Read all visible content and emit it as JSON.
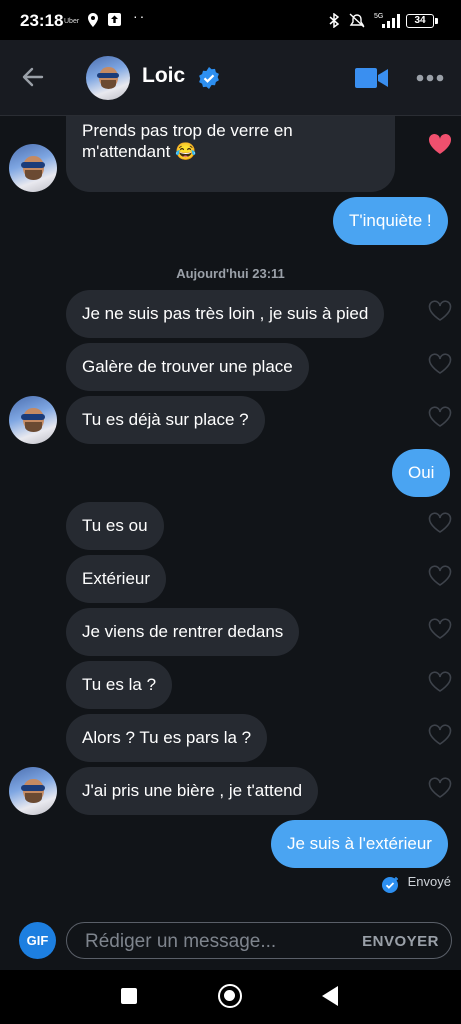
{
  "status_bar": {
    "time": "23:18",
    "uber": "Uber",
    "network": "5G",
    "battery": "34"
  },
  "header": {
    "contact_name": "Loic"
  },
  "messages": [
    {
      "direction": "in",
      "text": "Prends pas trop de verre en m'attendant 😂",
      "liked": true
    },
    {
      "direction": "out",
      "text": "T'inquiète !"
    },
    {
      "direction": "in",
      "text": "Je ne suis pas très loin , je suis à pied",
      "liked": false
    },
    {
      "direction": "in",
      "text": "Galère de trouver une place",
      "liked": false
    },
    {
      "direction": "in",
      "text": "Tu es déjà sur place ?",
      "liked": false
    },
    {
      "direction": "out",
      "text": "Oui"
    },
    {
      "direction": "in",
      "text": "Tu es ou",
      "liked": false
    },
    {
      "direction": "in",
      "text": "Extérieur",
      "liked": false
    },
    {
      "direction": "in",
      "text": "Je viens de rentrer dedans",
      "liked": false
    },
    {
      "direction": "in",
      "text": "Tu es la ?",
      "liked": false
    },
    {
      "direction": "in",
      "text": "Alors ? Tu es pars la ?",
      "liked": false
    },
    {
      "direction": "in",
      "text": "J'ai pris une bière , je t'attend",
      "liked": false
    },
    {
      "direction": "out",
      "text": "Je suis à l'extérieur"
    }
  ],
  "date_separator": "Aujourd'hui 23:11",
  "sent_status": "Envoyé",
  "composer": {
    "gif_label": "GIF",
    "placeholder": "Rédiger un message...",
    "send_label": "ENVOYER"
  },
  "colors": {
    "background": "#111418",
    "incoming_bubble": "#262a31",
    "outgoing_bubble": "#4aa4f2",
    "like": "#f0506e",
    "accent": "#1d7fe0"
  }
}
